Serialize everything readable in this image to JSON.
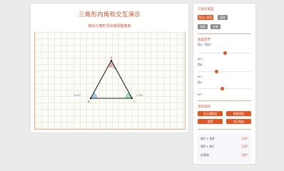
{
  "main": {
    "title": "三角形内角和交互演示",
    "subtitle": "拖动三角形顶点或调整角度"
  },
  "canvas": {
    "vertices": [
      {
        "name": "A",
        "angle_label": "60°"
      },
      {
        "name": "B",
        "angle_label": "B 60°"
      },
      {
        "name": "C",
        "angle_label": "C 60°"
      }
    ],
    "vertex_colors": {
      "A": "#e8a0a8",
      "B": "#9ec4ea",
      "C": "#9fd6a8"
    }
  },
  "sidebar": {
    "shape_section": {
      "title": "三角形类型",
      "buttons": [
        "等边三角形",
        "直角",
        "钝角",
        "任意"
      ]
    },
    "angle_section": {
      "title": "角度调节",
      "sliders": [
        {
          "label": "角A（顶点）",
          "value_label": "60°",
          "level": 0.8
        },
        {
          "label": "角B",
          "value_label": "60°",
          "level": 0.6
        },
        {
          "label": "角C",
          "value_label": "60°",
          "level": 0.6
        }
      ]
    },
    "action_section": {
      "title": "演示操作",
      "buttons": [
        "显示辅助线",
        "撕角拼接",
        "重置",
        "显示角度"
      ]
    },
    "info": {
      "rows": [
        {
          "label": "角A + 角B",
          "value": "120°"
        },
        {
          "label": "角B + 角C",
          "value": "120°"
        },
        {
          "label": "内角和",
          "value": "180°"
        }
      ]
    }
  },
  "colors": {
    "accent": "#e8541f",
    "title": "#d2532a",
    "gray_button": "#8c8c8c"
  }
}
